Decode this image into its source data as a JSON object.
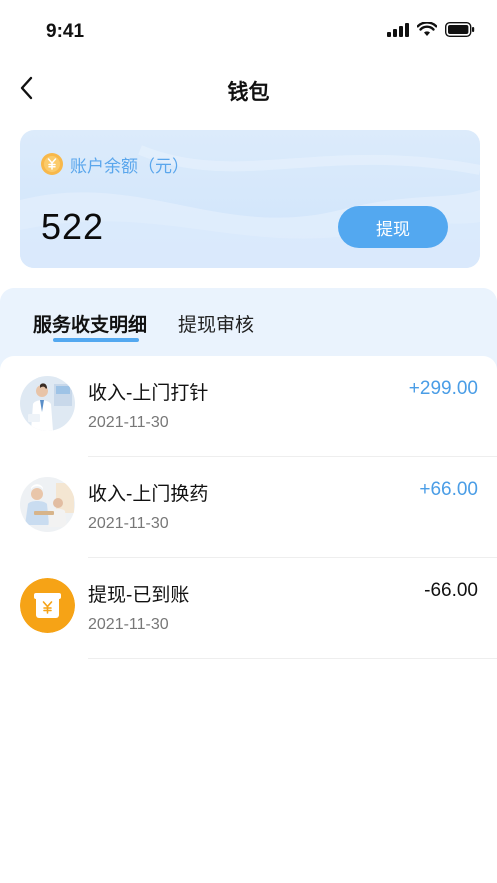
{
  "status_bar": {
    "time": "9:41"
  },
  "nav": {
    "title": "钱包"
  },
  "balance": {
    "label": "账户余额（元）",
    "amount": "522",
    "withdraw_label": "提现"
  },
  "tabs": [
    {
      "label": "服务收支明细",
      "active": true
    },
    {
      "label": "提现审核",
      "active": false
    }
  ],
  "records": [
    {
      "title": "收入-上门打针",
      "date": "2021-11-30",
      "amount": "+299.00",
      "type": "income",
      "avatar": "doctor-photo"
    },
    {
      "title": "收入-上门换药",
      "date": "2021-11-30",
      "amount": "+66.00",
      "type": "income",
      "avatar": "nurse-photo"
    },
    {
      "title": "提现-已到账",
      "date": "2021-11-30",
      "amount": "-66.00",
      "type": "withdraw",
      "avatar": "wallet-icon"
    }
  ],
  "colors": {
    "accent": "#53a8f0",
    "income": "#4a9de6",
    "withdraw": "#111111",
    "withdraw_icon_bg": "#f6a316"
  }
}
